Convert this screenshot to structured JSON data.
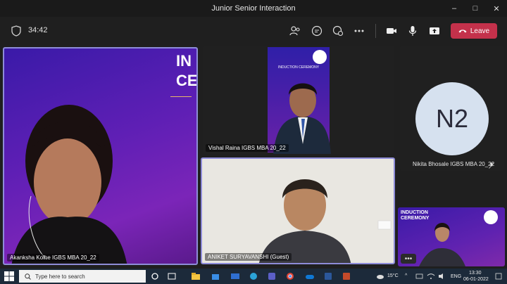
{
  "window": {
    "title": "Junior Senior Interaction",
    "controls": [
      "–",
      "□",
      "✕"
    ]
  },
  "toolbar": {
    "timer": "34:42",
    "leave_label": "Leave",
    "icons": [
      "participants-icon",
      "chat-icon",
      "reactions-icon",
      "more-icon",
      "camera-icon",
      "mic-icon",
      "share-icon"
    ]
  },
  "participants": {
    "akanksha": {
      "name": "Akanksha Kolhe IGBS MBA 20_22"
    },
    "vishal": {
      "name": "Vishal Raina IGBS MBA 20_22"
    },
    "nikita": {
      "name": "Nikita Bhosale IGBS MBA 20_22",
      "initials": "N2"
    },
    "aniket": {
      "name": "ANIKET SURYAVANSHI (Guest)"
    },
    "overflow": {
      "more_label": "•••"
    }
  },
  "banners": {
    "akanksha_text": [
      "IN",
      "CE"
    ],
    "induction_title": "INDUCTION CEREMONY",
    "vishal_banner": "INDUCTION CEREMONY"
  },
  "taskbar": {
    "search_placeholder": "Type here to search",
    "weather": "15°C",
    "language": "ENG",
    "time": "13:30",
    "date": "06-01-2022"
  }
}
